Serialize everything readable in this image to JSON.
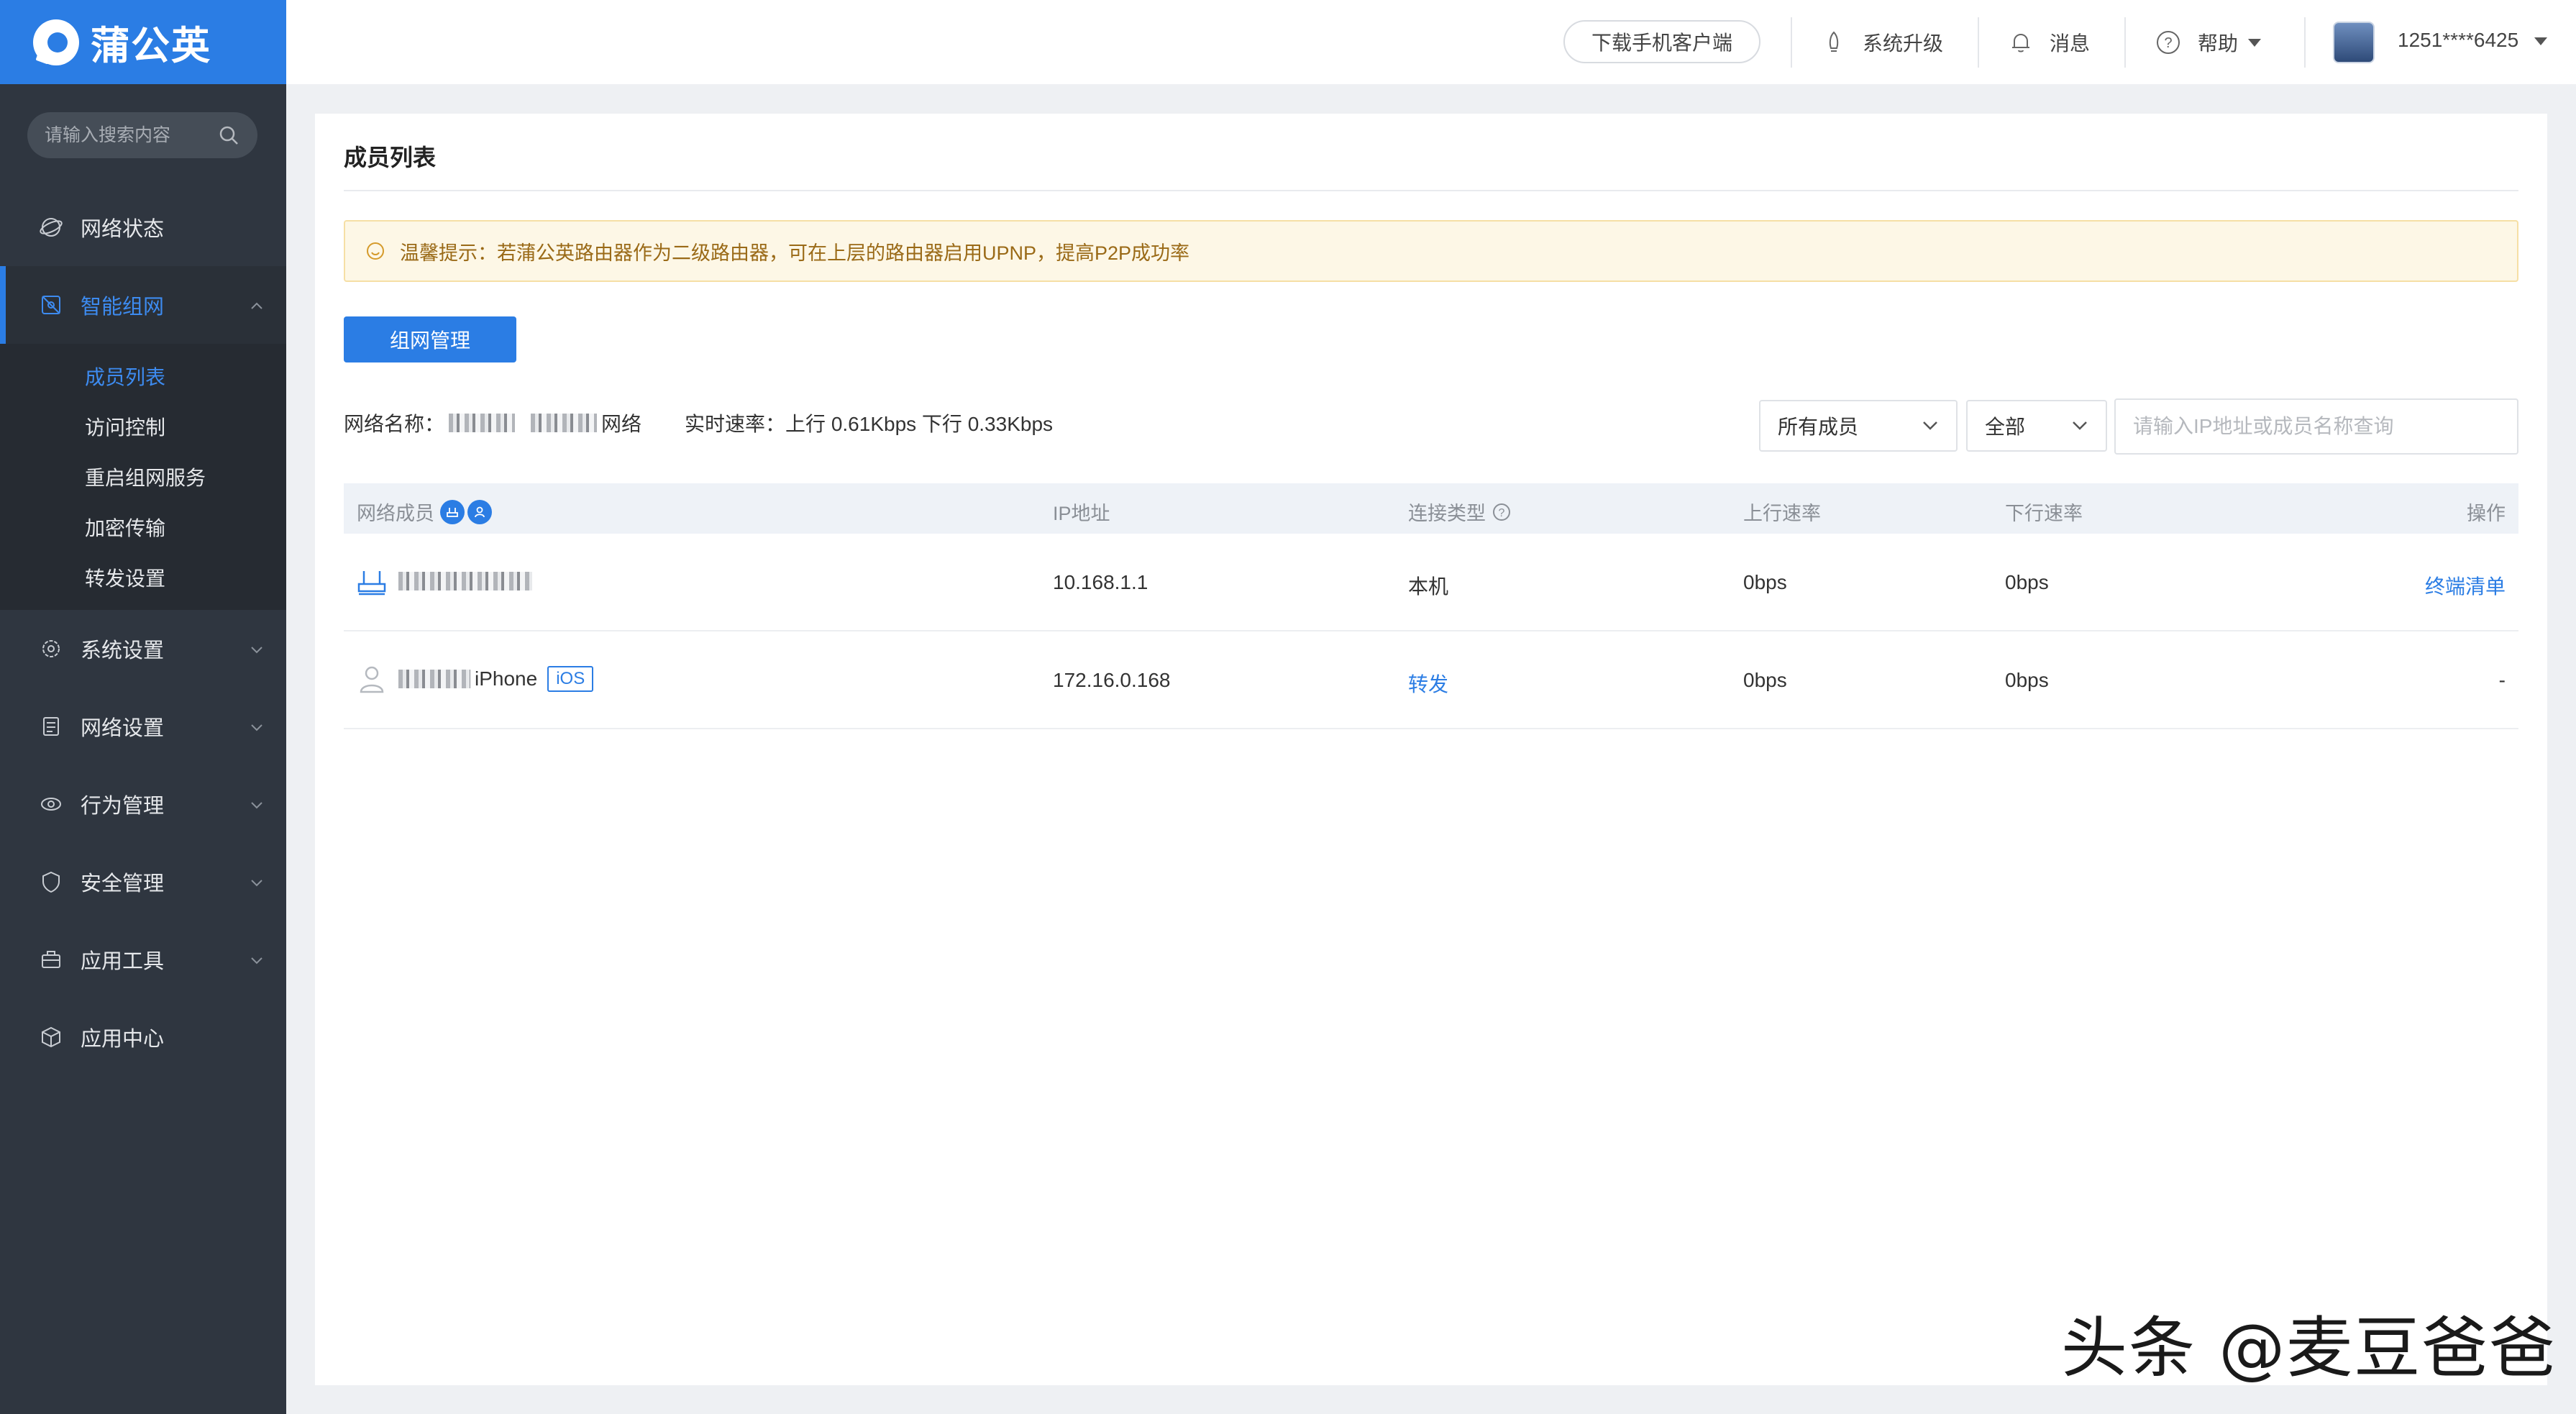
{
  "sidebar": {
    "logo_text": "蒲公英",
    "search_placeholder": "请输入搜索内容",
    "items": [
      {
        "label": "网络状态"
      },
      {
        "label": "智能组网"
      },
      {
        "label": "系统设置"
      },
      {
        "label": "网络设置"
      },
      {
        "label": "行为管理"
      },
      {
        "label": "安全管理"
      },
      {
        "label": "应用工具"
      },
      {
        "label": "应用中心"
      }
    ],
    "subitems": [
      {
        "label": "成员列表"
      },
      {
        "label": "访问控制"
      },
      {
        "label": "重启组网服务"
      },
      {
        "label": "加密传输"
      },
      {
        "label": "转发设置"
      }
    ]
  },
  "topbar": {
    "download_label": "下载手机客户端",
    "upgrade_label": "系统升级",
    "messages_label": "消息",
    "help_label": "帮助",
    "user_label": "1251****6425"
  },
  "main": {
    "title": "成员列表",
    "notice": "温馨提示：若蒲公英路由器作为二级路由器，可在上层的路由器启用UPNP，提高P2P成功率",
    "manage_button": "组网管理",
    "network_name_label": "网络名称：",
    "network_name_suffix": "网络",
    "speed_label": "实时速率：",
    "speed_value": "上行 0.61Kbps 下行 0.33Kbps",
    "filter_members": "所有成员",
    "filter_type": "全部",
    "query_placeholder": "请输入IP地址或成员名称查询"
  },
  "table": {
    "headers": {
      "member": "网络成员",
      "ip": "IP地址",
      "type": "连接类型",
      "up": "上行速率",
      "down": "下行速率",
      "action": "操作"
    },
    "rows": [
      {
        "name": "",
        "ip": "10.168.1.1",
        "type": "本机",
        "up": "0bps",
        "down": "0bps",
        "action": "终端清单"
      },
      {
        "name": "iPhone",
        "tag": "iOS",
        "ip": "172.16.0.168",
        "type": "转发",
        "up": "0bps",
        "down": "0bps",
        "action": "-"
      }
    ]
  },
  "watermark": "头条 @麦豆爸爸",
  "colors": {
    "accent": "#2b7de4",
    "sidebar": "#2f3640",
    "notice_bg": "#fdf7e6"
  }
}
